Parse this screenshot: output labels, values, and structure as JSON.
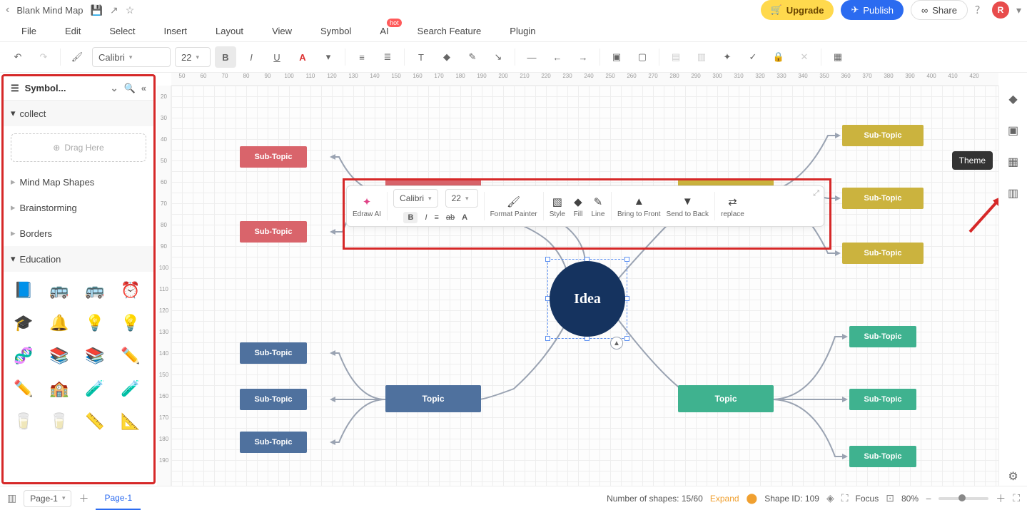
{
  "header": {
    "title": "Blank Mind Map",
    "upgrade": "Upgrade",
    "publish": "Publish",
    "share": "Share",
    "avatar_letter": "R"
  },
  "menu": {
    "items": [
      "File",
      "Edit",
      "Select",
      "Insert",
      "Layout",
      "View",
      "Symbol",
      "AI",
      "Search Feature",
      "Plugin"
    ],
    "hot_badge": "hot"
  },
  "toolbar": {
    "font": "Calibri",
    "size": "22"
  },
  "sidebar": {
    "title": "Symbol...",
    "sections": {
      "collect": "collect",
      "drag_here": "Drag Here",
      "mind_map_shapes": "Mind Map Shapes",
      "brainstorming": "Brainstorming",
      "borders": "Borders",
      "education": "Education"
    },
    "education_icons": [
      "📘",
      "🚌",
      "🚌",
      "⏰",
      "🎓",
      "🔔",
      "💡",
      "💡",
      "🧬",
      "📚",
      "📚",
      "✏️",
      "✏️",
      "🏫",
      "🧪",
      "🧪",
      "🥛",
      "🥛",
      "📏",
      "📐"
    ]
  },
  "canvas": {
    "idea": "Idea",
    "topic": "Topic",
    "subtopic": "Sub-Topic",
    "hruler": [
      "50",
      "60",
      "70",
      "80",
      "90",
      "100",
      "110",
      "120",
      "130",
      "140",
      "150",
      "160",
      "170",
      "180",
      "190",
      "200",
      "210",
      "220",
      "230",
      "240",
      "250",
      "260",
      "270",
      "280",
      "290",
      "300",
      "310",
      "320",
      "330",
      "340",
      "350",
      "360",
      "370",
      "380",
      "390",
      "400",
      "410",
      "420"
    ],
    "vruler": [
      "20",
      "30",
      "40",
      "50",
      "60",
      "70",
      "80",
      "90",
      "100",
      "110",
      "120",
      "130",
      "140",
      "150",
      "160",
      "170",
      "180",
      "190"
    ]
  },
  "mini_toolbar": {
    "edraw_ai": "Edraw AI",
    "font": "Calibri",
    "size": "22",
    "format_painter": "Format Painter",
    "style": "Style",
    "fill": "Fill",
    "line": "Line",
    "bring_front": "Bring to Front",
    "send_back": "Send to Back",
    "replace": "replace"
  },
  "right_panel": {
    "tooltip": "Theme"
  },
  "bottom": {
    "page_select": "Page-1",
    "page_tab": "Page-1",
    "shapes_label": "Number of shapes: ",
    "shapes_value": "15/60",
    "expand": "Expand",
    "shape_id_label": "Shape ID: ",
    "shape_id": "109",
    "focus": "Focus",
    "zoom": "80%"
  }
}
